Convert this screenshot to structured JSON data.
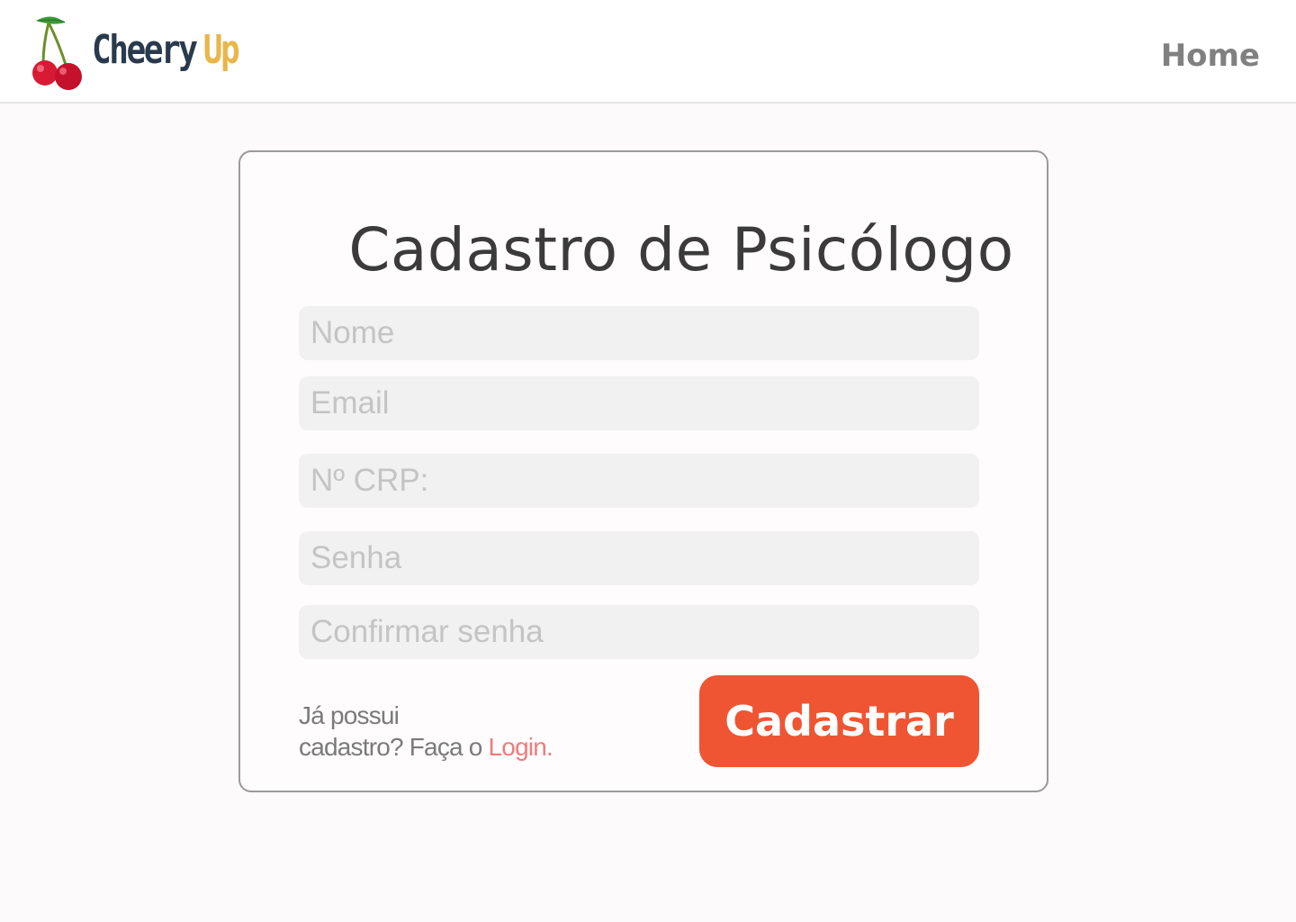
{
  "header": {
    "brand_primary": "Cheery",
    "brand_secondary": "Up",
    "nav_home": "Home",
    "colors": {
      "brand_primary": "#2a3a4d",
      "brand_secondary": "#e9b64a"
    }
  },
  "form": {
    "title": "Cadastro de Psicólogo",
    "fields": [
      {
        "placeholder": "Nome",
        "value": ""
      },
      {
        "placeholder": "Email",
        "value": ""
      },
      {
        "placeholder": "Nº CRP:",
        "value": ""
      },
      {
        "placeholder": "Senha",
        "value": ""
      },
      {
        "placeholder": "Confirmar senha",
        "value": ""
      }
    ],
    "login_prompt_line1": "Já possui",
    "login_prompt_line2": "cadastro? Faça o ",
    "login_link": "Login.",
    "submit_label": "Cadastrar",
    "colors": {
      "submit": "#ef5533",
      "login_link": "#f07b7b"
    }
  },
  "icons": {
    "logo": "cherry-icon"
  }
}
